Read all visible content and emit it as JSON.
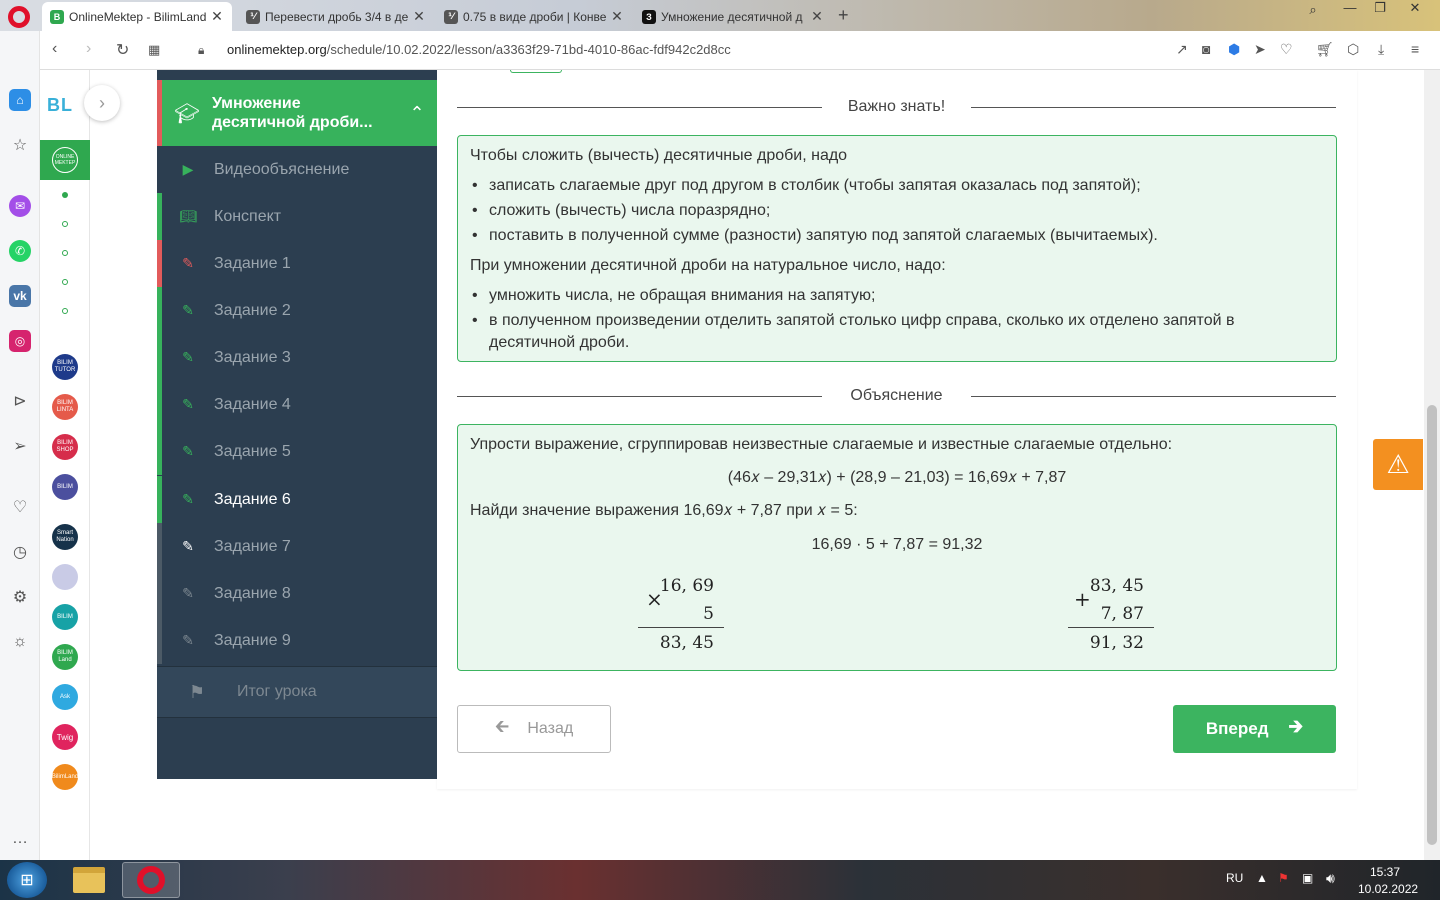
{
  "browser": {
    "tabs": [
      {
        "title": "OnlineMektep - BilimLand",
        "active": true,
        "favicon": "onlinemektep-favicon"
      },
      {
        "title": "Перевести дробь 3/4 в де",
        "active": false,
        "favicon": "calc-favicon"
      },
      {
        "title": "0.75 в виде дроби | Конве",
        "active": false,
        "favicon": "calc-favicon"
      },
      {
        "title": "Умножение десятичной д",
        "active": false,
        "favicon": "znanija-favicon"
      }
    ],
    "url_host": "onlinemektep.org",
    "url_path": "/schedule/10.02.2022/lesson/a3363f29-71bd-4010-86ac-fdf942c2d8cc"
  },
  "site": {
    "logo": "BL",
    "active_app_label": "ONLINE MEKTEP",
    "apps": [
      "BILIM TUTOR",
      "BILIM LINTA",
      "BILIM SHOP",
      "BILIM",
      "Smart Nation",
      "",
      "BILIM",
      "BILIM Land",
      "Ask",
      "Twig",
      "BilimLand"
    ]
  },
  "lesson": {
    "title": "Умножение десятичной дроби...",
    "items": [
      {
        "label": "Видеообъяснение",
        "icon": "play-icon"
      },
      {
        "label": "Конспект",
        "icon": "book-icon"
      },
      {
        "label": "Задание 1",
        "icon": "edit-icon"
      },
      {
        "label": "Задание 2",
        "icon": "edit-icon"
      },
      {
        "label": "Задание 3",
        "icon": "edit-icon"
      },
      {
        "label": "Задание 4",
        "icon": "edit-icon"
      },
      {
        "label": "Задание 5",
        "icon": "edit-icon"
      },
      {
        "label": "Задание 6",
        "icon": "edit-icon"
      },
      {
        "label": "Задание 7",
        "icon": "edit-icon"
      },
      {
        "label": "Задание 8",
        "icon": "edit-icon"
      },
      {
        "label": "Задание 9",
        "icon": "edit-icon"
      }
    ],
    "final": "Итог урока"
  },
  "important": {
    "heading": "Важно знать!",
    "intro_add": "Чтобы сложить (вычесть) десятичные дроби, надо",
    "add_rules": [
      "записать слагаемые друг под другом в столбик (чтобы запятая оказалась под запятой);",
      "сложить (вычесть) числа поразрядно;",
      "поставить в полученной сумме (разности) запятую под запятой слагаемых (вычитаемых)."
    ],
    "intro_mul": "При умножении десятичной дроби на натуральное число, надо:",
    "mul_rules": [
      "умножить числа, не обращая внимания на запятую;",
      "в полученном произведении отделить запятой столько цифр справа, сколько их отделено запятой в десятичной дроби."
    ]
  },
  "explanation": {
    "heading": "Объяснение",
    "step1": "Упрости выражение, сгруппировав неизвестные слагаемые и известные слагаемые отдельно:",
    "formula1": "(46𝑥 – 29,31𝑥) + (28,9 – 21,03) = 16,69𝑥 + 7,87",
    "step2": "Найди значение выражения 16,69𝑥 + 7,87 при 𝑥 = 5:",
    "formula2": "16,69 · 5 + 7,87 = 91,32",
    "mult": {
      "op": "×",
      "a": "16, 69",
      "b": "5",
      "result": "83, 45"
    },
    "add": {
      "op": "+",
      "a": "83, 45",
      "b": "7, 87",
      "result": "91, 32"
    }
  },
  "buttons": {
    "back": "Назад",
    "next": "Вперед"
  },
  "taskbar": {
    "lang": "RU",
    "time": "15:37",
    "date": "10.02.2022"
  },
  "colors": {
    "brand_green": "#3cb460",
    "panel_dark": "#2c3e50",
    "accent_red": "#e25b5b",
    "warn_orange": "#f39020"
  }
}
